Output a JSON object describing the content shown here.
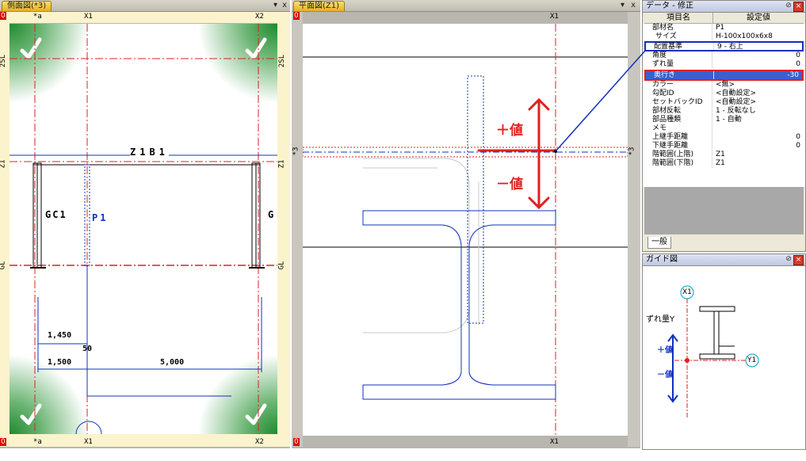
{
  "left_pane": {
    "tab": "側面図(*3)",
    "pin": "▾",
    "close": "x",
    "top_labels": [
      "*a",
      "X1",
      "X2"
    ],
    "bottom_labels": [
      "*a",
      "X1",
      "X2"
    ],
    "left_labels": [
      "2SL",
      "Z1",
      "GL"
    ],
    "right_labels": [
      "2SL",
      "Z1",
      "GL"
    ],
    "corner_top": "0",
    "corner_bottom": "0",
    "beam_label": "Z1B1",
    "col_left": "GC1",
    "col_right": "G",
    "post_label": "P1",
    "dims": [
      "1,450",
      "50",
      "1,500",
      "5,000"
    ]
  },
  "plan_pane": {
    "tab": "平面図(Z1)",
    "pin": "▾",
    "close": "x",
    "top_label": "X1",
    "bottom_label": "X1",
    "side_label": "*3",
    "corner_top": "0",
    "corner_bottom": "0",
    "plus_label": "＋値",
    "minus_label": "－値"
  },
  "props": {
    "title": "データ - 修正",
    "col_name": "項目名",
    "col_value": "設定値",
    "rows": [
      {
        "k": "部材名",
        "v": "P1"
      },
      {
        "k": "サイズ",
        "v": "H-100x100x6x8"
      },
      {
        "k": "配置基準",
        "v": "9 - 右上"
      },
      {
        "k": "角度",
        "v": "0"
      },
      {
        "k": "ずれ量",
        "v": "0"
      },
      {
        "k": "奥行き",
        "v": "-30"
      },
      {
        "k": "カラー",
        "v": "<無>"
      },
      {
        "k": "勾配ID",
        "v": "<自動設定>"
      },
      {
        "k": "セットバックID",
        "v": "<自動設定>"
      },
      {
        "k": "部材反転",
        "v": "1 - 反転なし"
      },
      {
        "k": "部品種類",
        "v": "1 - 自動"
      },
      {
        "k": "メモ",
        "v": ""
      },
      {
        "k": "上継手距離",
        "v": "0"
      },
      {
        "k": "下継手距離",
        "v": "0"
      },
      {
        "k": "階範囲(上階)",
        "v": "Z1"
      },
      {
        "k": "階範囲(下階)",
        "v": "Z1"
      }
    ],
    "tab_general": "一般"
  },
  "guide": {
    "title": "ガイド図",
    "label_x": "X1",
    "label_y": "Y1",
    "offset_label": "ずれ量Y",
    "plus": "＋値",
    "minus": "－値"
  },
  "colors": {
    "accent_red": "#e02020",
    "accent_blue": "#1030c0",
    "ok_green": "#2a8a3a"
  }
}
